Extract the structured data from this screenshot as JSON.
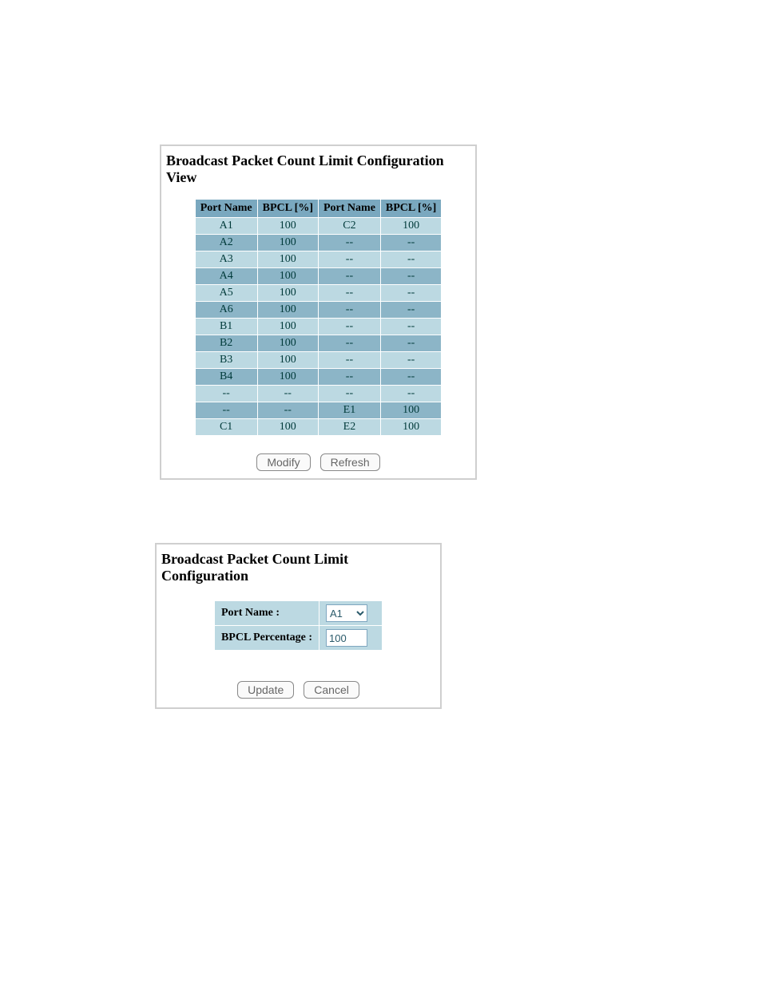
{
  "view": {
    "title": "Broadcast Packet Count Limit Configuration View",
    "columns": [
      "Port Name",
      "BPCL [%]",
      "Port Name",
      "BPCL [%]"
    ],
    "rows": [
      {
        "c0": "A1",
        "c1": "100",
        "c2": "C2",
        "c3": "100"
      },
      {
        "c0": "A2",
        "c1": "100",
        "c2": "--",
        "c3": "--"
      },
      {
        "c0": "A3",
        "c1": "100",
        "c2": "--",
        "c3": "--"
      },
      {
        "c0": "A4",
        "c1": "100",
        "c2": "--",
        "c3": "--"
      },
      {
        "c0": "A5",
        "c1": "100",
        "c2": "--",
        "c3": "--"
      },
      {
        "c0": "A6",
        "c1": "100",
        "c2": "--",
        "c3": "--"
      },
      {
        "c0": "B1",
        "c1": "100",
        "c2": "--",
        "c3": "--"
      },
      {
        "c0": "B2",
        "c1": "100",
        "c2": "--",
        "c3": "--"
      },
      {
        "c0": "B3",
        "c1": "100",
        "c2": "--",
        "c3": "--"
      },
      {
        "c0": "B4",
        "c1": "100",
        "c2": "--",
        "c3": "--"
      },
      {
        "c0": "--",
        "c1": "--",
        "c2": "--",
        "c3": "--"
      },
      {
        "c0": "--",
        "c1": "--",
        "c2": "E1",
        "c3": "100"
      },
      {
        "c0": "C1",
        "c1": "100",
        "c2": "E2",
        "c3": "100"
      }
    ],
    "buttons": {
      "modify": "Modify",
      "refresh": "Refresh"
    }
  },
  "config": {
    "title": "Broadcast Packet Count Limit Configuration",
    "labels": {
      "port_name": "Port Name :",
      "bpcl_pct": "BPCL Percentage :"
    },
    "values": {
      "port_name_selected": "A1",
      "bpcl_pct": "100"
    },
    "buttons": {
      "update": "Update",
      "cancel": "Cancel"
    }
  }
}
